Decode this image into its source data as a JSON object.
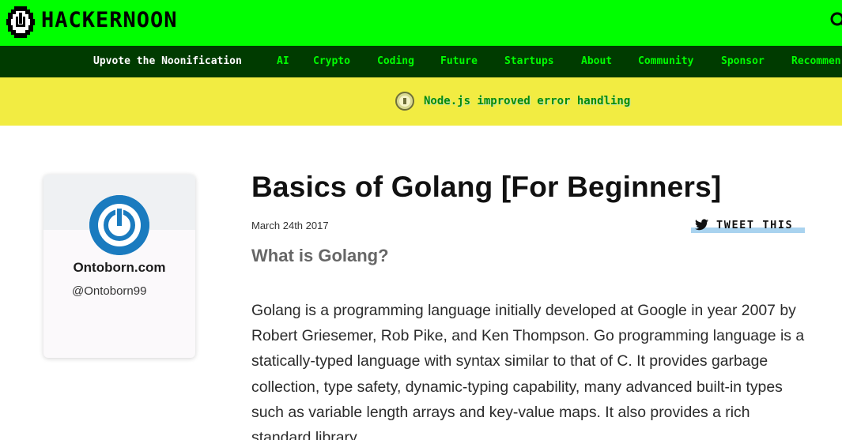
{
  "header": {
    "logo_text": "HACKERNOON",
    "logo_icon": "hackernoon-logo-icon",
    "search_icon": "search-icon",
    "brand_color": "#00ff00"
  },
  "nav": {
    "items": [
      {
        "label": "Upvote the Noonification"
      },
      {
        "label": "AI"
      },
      {
        "label": "Crypto"
      },
      {
        "label": "Coding"
      },
      {
        "label": "Future"
      },
      {
        "label": "Startups"
      },
      {
        "label": "About"
      },
      {
        "label": "Community"
      },
      {
        "label": "Sponsor"
      },
      {
        "label": "Recommen"
      }
    ],
    "background": "#003b00",
    "link_color": "#00ff00"
  },
  "banner": {
    "text": "Node.js improved error handling",
    "icon": "nodejs-badge-icon",
    "background": "#f2ec42"
  },
  "author": {
    "name": "Ontoborn.com",
    "handle": "@Ontoborn99",
    "avatar_color": "#1a7bbf"
  },
  "article": {
    "title": "Basics of Golang [For Beginners]",
    "date": "March 24th 2017",
    "tweet_label": "TWEET THIS",
    "subheading": "What is Golang?",
    "body": "Golang is a programming language initially developed at Google in year 2007 by Robert Griesemer, Rob Pike, and Ken Thompson. Go programming language is a statically-typed language with syntax similar to that of C. It provides garbage collection, type safety, dynamic-typing capability, many advanced built-in types such as variable length arrays and key-value maps. It also provides a rich standard library."
  }
}
